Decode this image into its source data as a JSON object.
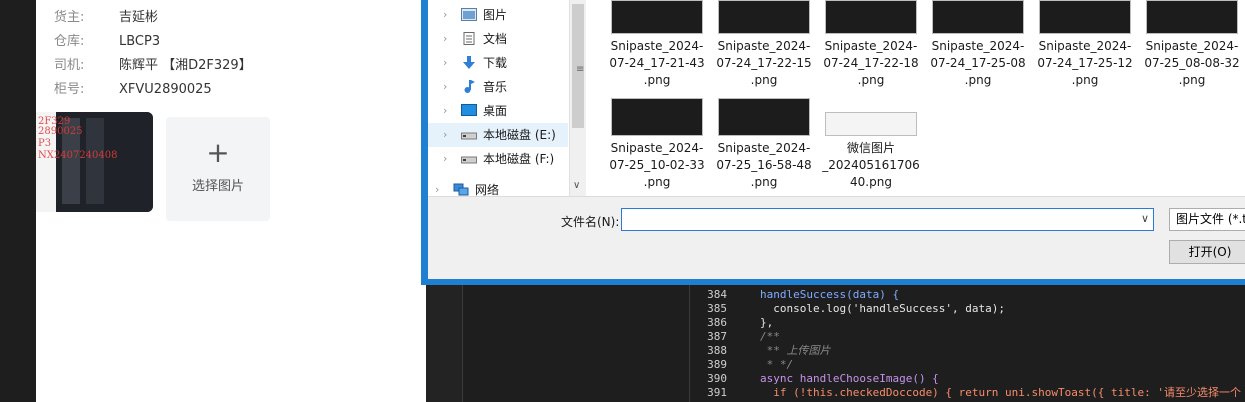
{
  "form": {
    "fields": [
      {
        "label": "货主:",
        "value": "吉延彬"
      },
      {
        "label": "仓库:",
        "value": "LBCP3"
      },
      {
        "label": "司机:",
        "value": "陈辉平 【湘D2F329】"
      },
      {
        "label": "柜号:",
        "value": "XFVU2890025"
      }
    ],
    "thumbnail_watermark": [
      "2F329",
      "2890025",
      "P3",
      "NX2407240408"
    ],
    "add_image_label": "选择图片",
    "add_icon": "plus-icon"
  },
  "file_dialog": {
    "nav_items": [
      {
        "label": "图片",
        "icon": "pictures-folder-icon"
      },
      {
        "label": "文档",
        "icon": "documents-folder-icon"
      },
      {
        "label": "下载",
        "icon": "download-arrow-icon"
      },
      {
        "label": "音乐",
        "icon": "music-note-icon"
      },
      {
        "label": "桌面",
        "icon": "desktop-folder-icon"
      },
      {
        "label": "本地磁盘 (E:)",
        "icon": "drive-icon",
        "selected": true
      },
      {
        "label": "本地磁盘 (F:)",
        "icon": "drive-icon"
      },
      {
        "label": "网络",
        "icon": "network-icon"
      }
    ],
    "files": [
      {
        "name_lines": [
          "Snipaste_2024-",
          "07-24_17-21-43",
          ".png"
        ]
      },
      {
        "name_lines": [
          "Snipaste_2024-",
          "07-24_17-22-15",
          ".png"
        ]
      },
      {
        "name_lines": [
          "Snipaste_2024-",
          "07-24_17-22-18",
          ".png"
        ]
      },
      {
        "name_lines": [
          "Snipaste_2024-",
          "07-24_17-25-08",
          ".png"
        ]
      },
      {
        "name_lines": [
          "Snipaste_2024-",
          "07-24_17-25-12",
          ".png"
        ]
      },
      {
        "name_lines": [
          "Snipaste_2024-",
          "07-25_08-08-32",
          ".png"
        ]
      },
      {
        "name_lines": [
          "Snipaste_2024-",
          "07-25_10-02-33",
          ".png"
        ]
      },
      {
        "name_lines": [
          "Snipaste_2024-",
          "07-25_16-58-48",
          ".png"
        ]
      },
      {
        "name_lines": [
          "微信图片",
          "_202405161706",
          "40.png"
        ]
      }
    ],
    "filename_label": "文件名(N):",
    "filename_value": "",
    "filetype_value": "图片文件 (*.tif",
    "open_button": "打开(O)"
  },
  "editor": {
    "lines": [
      {
        "no": "384",
        "text": "handleSuccess(data) {"
      },
      {
        "no": "385",
        "text": "  console.log('handleSuccess', data);"
      },
      {
        "no": "386",
        "text": "},"
      },
      {
        "no": "387",
        "text": "/**"
      },
      {
        "no": "388",
        "text": " ** 上传图片"
      },
      {
        "no": "389",
        "text": " * */"
      },
      {
        "no": "390",
        "text": "async handleChooseImage() {"
      },
      {
        "no": "391",
        "text": "  if (!this.checkedDoccode) { return uni.showToast({ title: '请至少选择一个"
      }
    ]
  },
  "colors": {
    "dialog_border": "#1f7fd0",
    "selection": "#e5f1fb",
    "editor_bg": "#1e1e1e"
  }
}
